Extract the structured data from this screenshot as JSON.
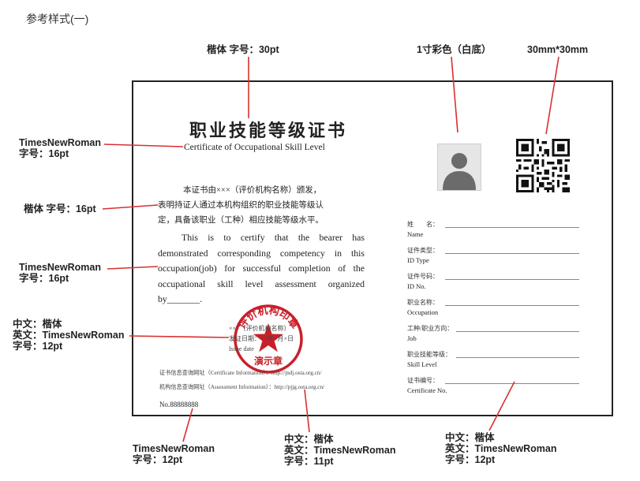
{
  "page_title": "参考样式(一)",
  "annotations": {
    "title_font": "楷体 字号：30pt",
    "photo": "1寸彩色（白底）",
    "qr": "30mm*30mm",
    "subtitle": [
      "TimesNewRoman",
      "字号：16pt"
    ],
    "zh_body": "楷体 字号：16pt",
    "en_body": [
      "TimesNewRoman",
      "字号：16pt"
    ],
    "seal": [
      "中文：楷体",
      "英文：TimesNewRoman",
      "字号：12pt"
    ],
    "cert_no": [
      "TimesNewRoman",
      "字号：12pt"
    ],
    "info": [
      "中文：楷体",
      "英文：TimesNewRoman",
      "字号：11pt"
    ],
    "fields": [
      "中文：楷体",
      "英文：TimesNewRoman",
      "字号：12pt"
    ]
  },
  "certificate": {
    "title": "职业技能等级证书",
    "subtitle": "Certificate of Occupational Skill Level",
    "zh_body": [
      "本证书由×××（评价机构名称）颁发，",
      "表明持证人通过本机构组织的职业技能等级认",
      "定，具备该职业（工种）相应技能等级水平。"
    ],
    "en_body": "This is to certify that the bearer has demonstrated corresponding competency in this occupation(job) for successful completion of the occupational skill level assessment organized by_______.",
    "seal": {
      "outer_text": "评价机构印章",
      "bottom_text": "演示章",
      "line1": "×××（评价机构名称）",
      "line2": "发证日期：××年×月×日",
      "line3": "Issue date"
    },
    "info_line1": "证书信息查询网址（Certificate Information）：http://jndj.osta.org.cn/",
    "info_line2": "机构信息查询网址（Assessment Information）：http://pjjg.osta.org.cn/",
    "cert_no": "No.88888888",
    "fields": [
      {
        "zh": "姓　　名：",
        "en": "Name"
      },
      {
        "zh": "证件类型：",
        "en": "ID Type"
      },
      {
        "zh": "证件号码：",
        "en": "ID No."
      },
      {
        "zh": "职业名称：",
        "en": "Occupation"
      },
      {
        "zh": "工种/职业方向：",
        "en": "Job"
      },
      {
        "zh": "职业技能等级：",
        "en": "Skill Level"
      },
      {
        "zh": "证书编号：",
        "en": "Certificate No."
      }
    ]
  },
  "colors": {
    "callout": "#d93030",
    "seal": "#c8202a",
    "border": "#222222"
  }
}
